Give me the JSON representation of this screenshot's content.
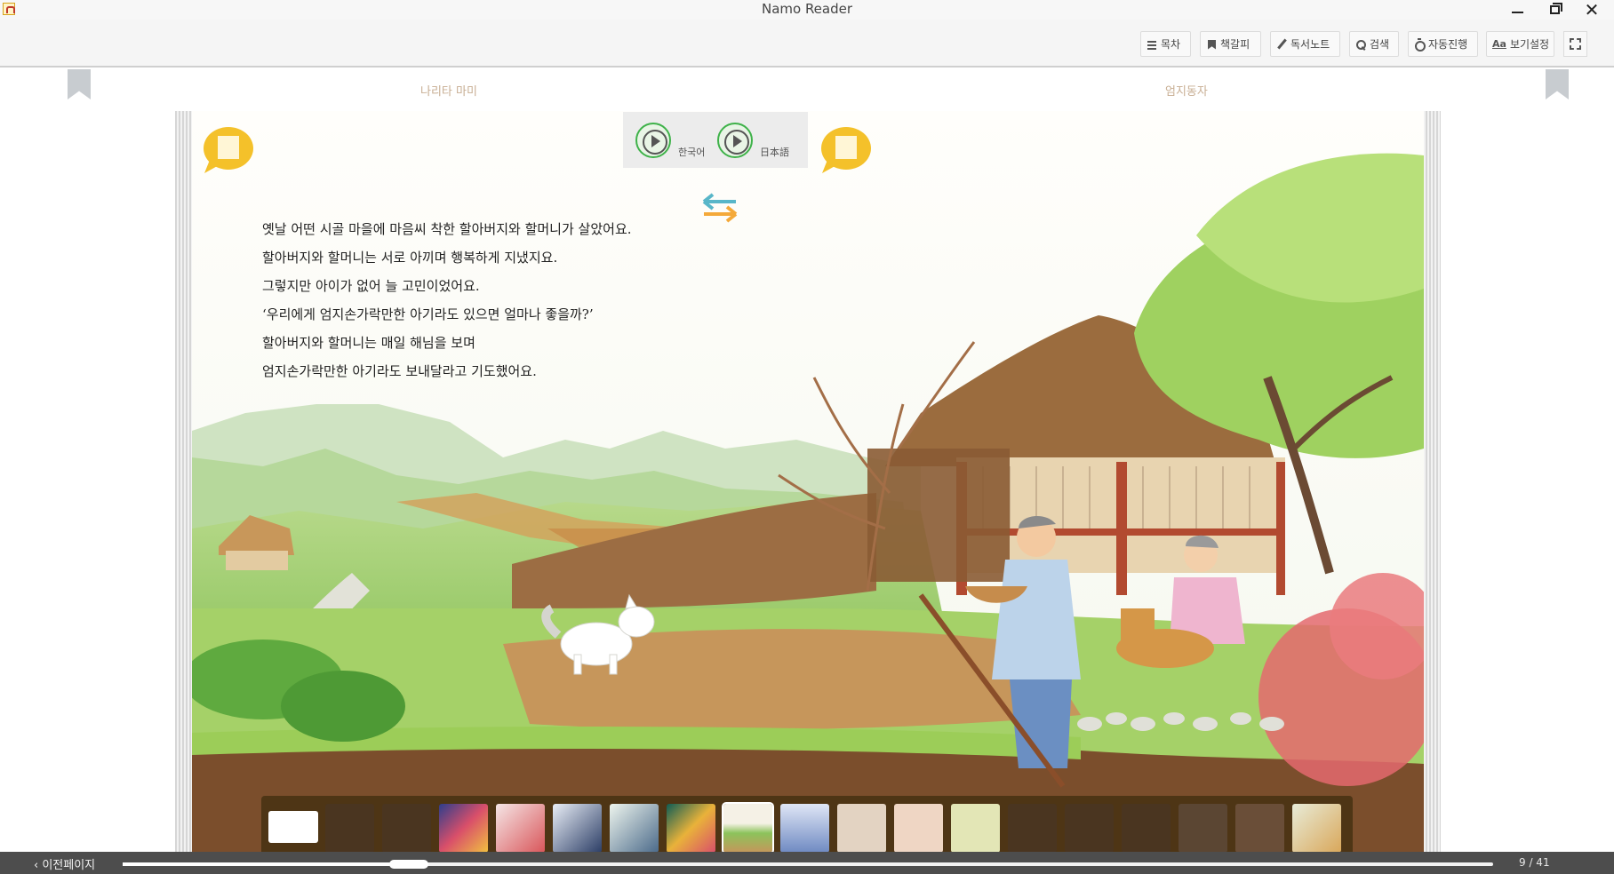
{
  "window": {
    "title": "Namo Reader"
  },
  "toolbar": {
    "toc_label": "목차",
    "bookmark_label": "책갈피",
    "note_label": "독서노트",
    "search_label": "검색",
    "autoplay_label": "자동진행",
    "view_settings_icon_text": "Aa",
    "view_settings_label": "보기설정"
  },
  "book": {
    "left_header": "나리타 마미",
    "right_header": "엄지동자",
    "audio": {
      "korean_label": "한국어",
      "japanese_label": "日本語"
    },
    "story_lines": [
      "옛날 어떤 시골 마을에 마음씨 착한 할아버지와 할머니가 살았어요.",
      "할아버지와 할머니는 서로 아끼며 행복하게 지냈지요.",
      "그렇지만 아이가 없어 늘 고민이었어요.",
      "‘우리에게 엄지손가락만한 아기라도 있으면 얼마나 좋을까?’",
      "할아버지와 할머니는 매일 해님을 보며",
      "엄지손가락만한 아기라도 보내달라고 기도했어요."
    ]
  },
  "thumbnails": {
    "count_visible": 20,
    "selected_index": 8
  },
  "navigation": {
    "prev_label": "이전페이지",
    "page_counter": "9 / 41",
    "current_page": 9,
    "total_pages": 41
  },
  "colors": {
    "accent_green": "#3fb24a",
    "speech_yellow": "#f4c12a",
    "thumb_strip": "#48321a"
  }
}
